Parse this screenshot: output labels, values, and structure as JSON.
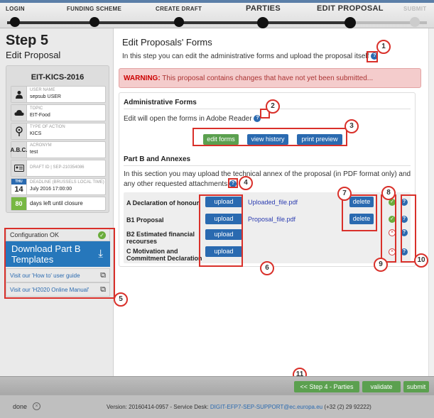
{
  "wizard": {
    "steps": [
      "LOGIN",
      "FUNDING SCHEME",
      "CREATE DRAFT",
      "PARTIES",
      "EDIT PROPOSAL",
      "SUBMIT"
    ]
  },
  "sidebar": {
    "step_title": "Step 5",
    "step_subtitle": "Edit Proposal",
    "proposal_id": "EIT-KICS-2016",
    "fields": [
      {
        "label": "USER NAME",
        "value": "sepsub USER",
        "icon": "user-icon"
      },
      {
        "label": "TOPIC",
        "value": "EIT-Food",
        "icon": "cloud-icon"
      },
      {
        "label": "TYPE OF ACTION",
        "value": "KICS",
        "icon": "action-type-icon"
      },
      {
        "label": "ACRONYM",
        "value": "test",
        "icon": "acronym-icon"
      },
      {
        "label": "DRAFT ID",
        "value": "SEP-210354086",
        "icon": "id-card-icon"
      }
    ],
    "deadline": {
      "day_name": "THU",
      "day": "14",
      "label": "DEADLINE (Brussels Local Time)",
      "value": "July 2016 17:00:00"
    },
    "days_left": {
      "count": "80",
      "text": "days left until closure"
    },
    "config": {
      "status": "Configuration OK",
      "download_label": "Download Part B Templates",
      "link1": "Visit our 'How to' user guide",
      "link2": "Visit our 'H2020 Online Manual'"
    }
  },
  "main": {
    "title": "Edit Proposals' Forms",
    "intro": "In this step you can edit the administrative forms and upload the proposal itself",
    "warning_prefix": "WARNING:",
    "warning_text": " This proposal contains changes that have not yet been submitted...",
    "admin": {
      "title": "Administrative Forms",
      "text": "Edit will open the forms in Adobe Reader",
      "edit_forms": "edit forms",
      "view_history": "view history",
      "print_preview": "print preview"
    },
    "partb": {
      "title": "Part B and Annexes",
      "text1": "In this section you may upload the technical annex of the proposal (in PDF format only) and",
      "text2": "any other requested attachments",
      "upload_label": "upload",
      "delete_label": "delete",
      "rows": [
        {
          "name": "A Declaration of honour",
          "file": "Uploaded_file.pdf",
          "status": "ok"
        },
        {
          "name": "B1 Proposal",
          "file": "Proposal_file.pdf",
          "status": "ok"
        },
        {
          "name": "B2 Estimated financial recourses",
          "file": "",
          "status": "error"
        },
        {
          "name": "C Motivation and Commitment Declaration",
          "file": "",
          "status": "error"
        }
      ]
    }
  },
  "actions": {
    "back": "<< Step 4 - Parties",
    "validate": "validate",
    "submit": "submit"
  },
  "footer": {
    "done": "done",
    "version": "Version: 20160414-0957 - Service Desk: ",
    "email": "DIGIT-EFP7-SEP-SUPPORT@ec.europa.eu",
    "phone": " (+32 (2) 29 92222)"
  },
  "callouts": [
    "1",
    "2",
    "3",
    "4",
    "5",
    "6",
    "7",
    "8",
    "9",
    "10",
    "11"
  ],
  "colors": {
    "primary": "#2a6ab0",
    "success": "#5ba04f",
    "warning_bg": "#f4cccc",
    "callout": "#d9302a"
  }
}
